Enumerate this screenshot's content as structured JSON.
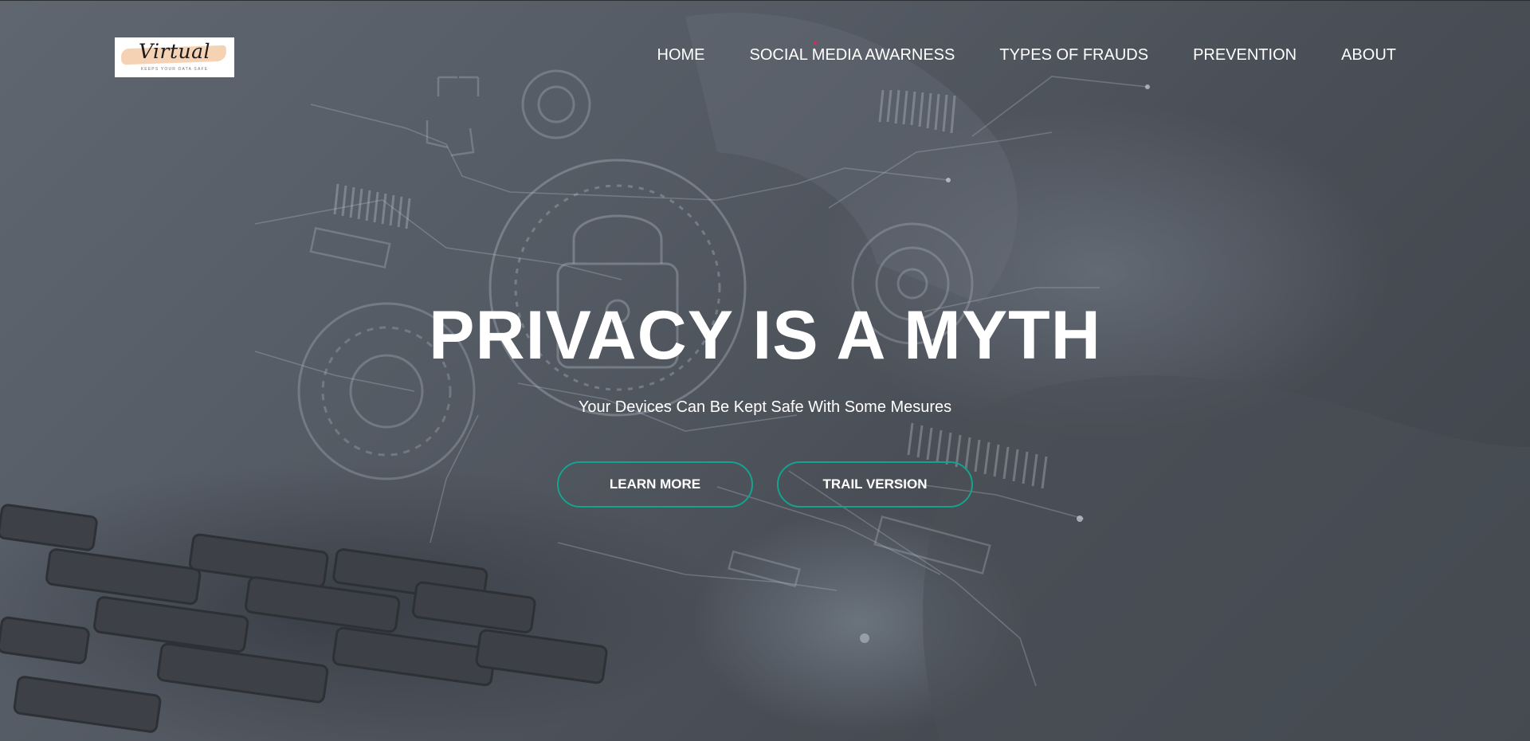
{
  "brand": {
    "logo_word": "Virtual",
    "logo_tagline": "KEEPS YOUR DATA SAFE",
    "swash_color": "#f6d2b4"
  },
  "nav": {
    "items": [
      {
        "label": "HOME"
      },
      {
        "label": "SOCIAL MEDIA AWARNESS"
      },
      {
        "label": "TYPES OF FRAUDS"
      },
      {
        "label": "PREVENTION"
      },
      {
        "label": "ABOUT"
      }
    ]
  },
  "hero": {
    "headline": "PRIVACY IS A MYTH",
    "subtitle": "Your Devices Can Be Kept Safe With Some Mesures",
    "buttons": {
      "learn_more": "LEARN MORE",
      "trail_version": "TRAIL VERSION"
    },
    "background_subject": "hand-on-laptop-keyboard-with-cybersecurity-lock-overlay"
  },
  "colors": {
    "accent": "#14a38f",
    "text": "#ffffff",
    "nav_dot": "#e6245a"
  }
}
